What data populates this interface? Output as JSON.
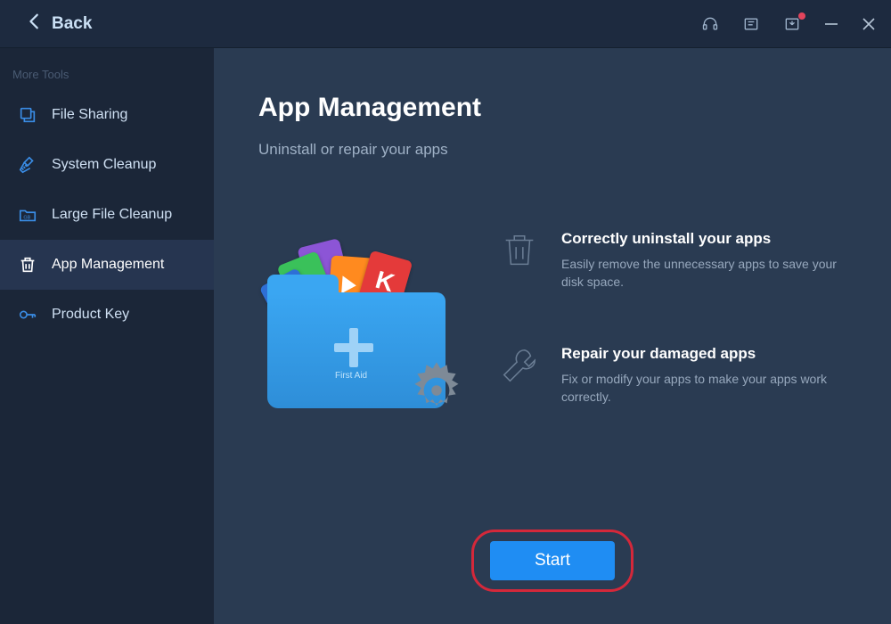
{
  "titlebar": {
    "back_label": "Back"
  },
  "sidebar": {
    "heading": "More Tools",
    "items": [
      {
        "label": "File Sharing"
      },
      {
        "label": "System Cleanup"
      },
      {
        "label": "Large File Cleanup"
      },
      {
        "label": "App Management"
      },
      {
        "label": "Product Key"
      }
    ],
    "active_index": 3
  },
  "main": {
    "title": "App Management",
    "subtitle": "Uninstall or repair your apps",
    "folder_label": "First Aid",
    "features": [
      {
        "title": "Correctly uninstall your apps",
        "desc": "Easily remove the unnecessary apps to save your disk space."
      },
      {
        "title": "Repair your damaged apps",
        "desc": "Fix or modify your apps to make your apps work correctly."
      }
    ],
    "start_label": "Start"
  }
}
